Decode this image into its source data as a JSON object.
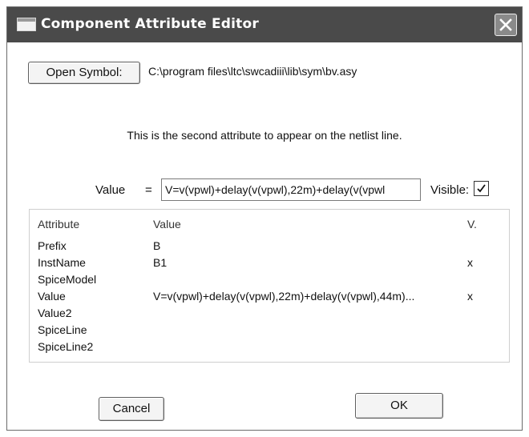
{
  "window": {
    "title": "Component Attribute Editor"
  },
  "symbol": {
    "open_label": "Open Symbol:",
    "path": "C:\\program files\\ltc\\swcadiii\\lib\\sym\\bv.asy"
  },
  "description": "This is the second attribute to appear on the netlist line.",
  "value_field": {
    "label": "Value",
    "equals": "=",
    "value": "V=v(vpwl)+delay(v(vpwl),22m)+delay(v(vpwl",
    "visible_label": "Visible:",
    "visible_checked": true
  },
  "attributes_table": {
    "headers": [
      "Attribute",
      "Value",
      "V."
    ],
    "rows": [
      {
        "attribute": "Prefix",
        "value": "B",
        "visible": ""
      },
      {
        "attribute": "InstName",
        "value": "B1",
        "visible": "x"
      },
      {
        "attribute": "SpiceModel",
        "value": "",
        "visible": ""
      },
      {
        "attribute": "Value",
        "value": "V=v(vpwl)+delay(v(vpwl),22m)+delay(v(vpwl),44m)...",
        "visible": "x"
      },
      {
        "attribute": "Value2",
        "value": "",
        "visible": ""
      },
      {
        "attribute": "SpiceLine",
        "value": "",
        "visible": ""
      },
      {
        "attribute": "SpiceLine2",
        "value": "",
        "visible": ""
      }
    ]
  },
  "buttons": {
    "cancel": "Cancel",
    "ok": "OK"
  }
}
